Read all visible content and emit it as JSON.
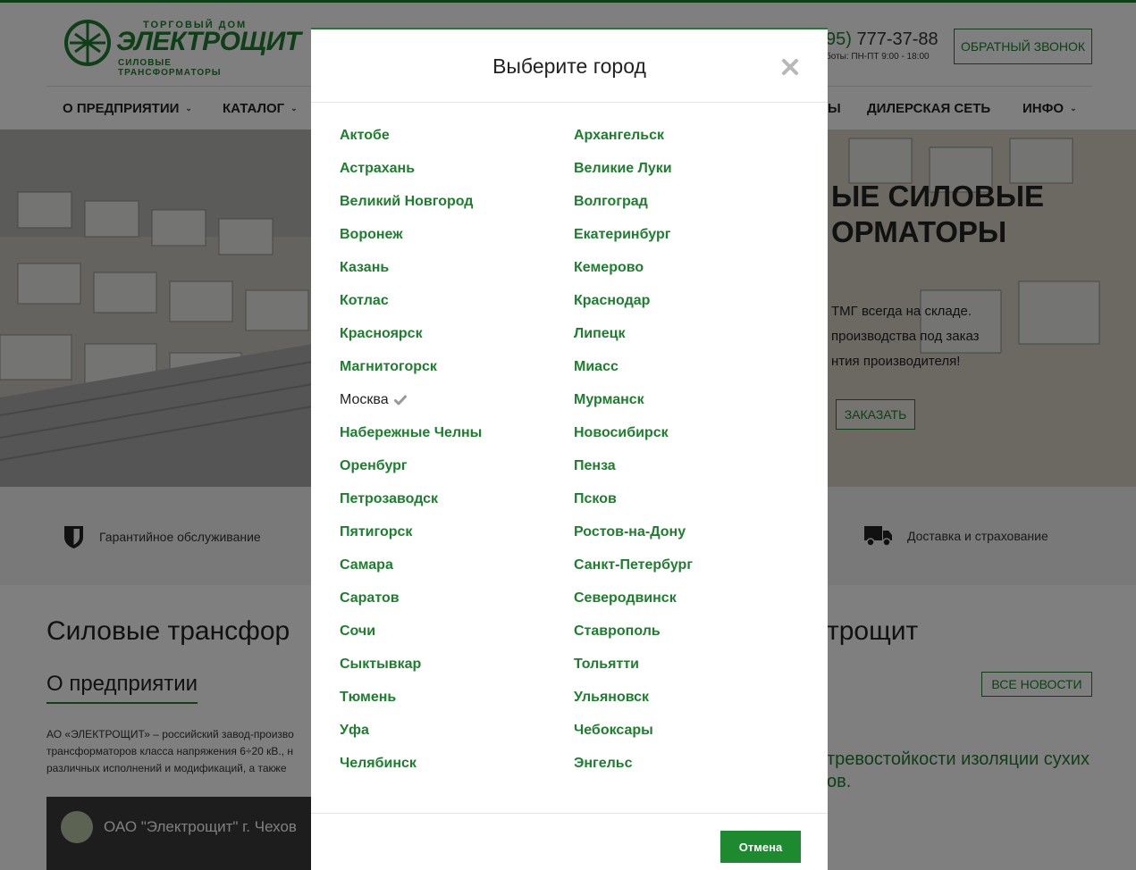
{
  "header": {
    "logo_top": "ТОРГОВЫЙ ДОМ",
    "logo_main": "ЭЛЕКТРОЩИТ",
    "logo_sub": "СИЛОВЫЕ ТРАНСФОРМАТОРЫ",
    "phone_code": "95)",
    "phone_number": " 777-37-88",
    "hours": "боты: ПН-ПТ 9:00 - 18:00",
    "callback_label": "ОБРАТНЫЙ ЗВОНОК"
  },
  "nav": {
    "items": [
      {
        "label": "О ПРЕДПРИЯТИИ",
        "caret": "⌄"
      },
      {
        "label": "КАТАЛОГ",
        "caret": "⌄"
      },
      {
        "label": "Ы",
        "caret": ""
      },
      {
        "label": "ДИЛЕРСКАЯ СЕТЬ",
        "caret": ""
      },
      {
        "label": "ИНФО",
        "caret": "⌄"
      }
    ]
  },
  "hero": {
    "title_line1": "ЫЕ СИЛОВЫЕ",
    "title_line2": "ОРМАТОРЫ",
    "text_line1": "ТМГ всегда на складе.",
    "text_line2": "производства под заказ",
    "text_line3": "нтия производителя!",
    "order_label": "ЗАКАЗАТЬ"
  },
  "features": {
    "warranty": "Гарантийное обслуживание",
    "delivery": "Доставка и страхование"
  },
  "content": {
    "main_heading": "Силовые трансфор",
    "main_heading_right": "трощит",
    "about_heading": "О предприятии",
    "news_button": "ВСЕ НОВОСТИ",
    "about_text": "АО «ЭЛЕКТРОЩИТ» – российский завод-произво трансформаторов класса напряжения 6÷20 кВ., н различных исполнений и модификаций, а также",
    "news_text": "тревостойкости изоляции сухих ов.",
    "video_title": "ОАО \"Электрощит\" г. Чехов"
  },
  "modal": {
    "title": "Выберите город",
    "cancel_label": "Отмена",
    "current_city": "Москва",
    "left_cities": [
      "Актобе",
      "Астрахань",
      "Великий Новгород",
      "Воронеж",
      "Казань",
      "Котлас",
      "Красноярск",
      "Магнитогорск",
      "Москва",
      "Набережные Челны",
      "Оренбург",
      "Петрозаводск",
      "Пятигорск",
      "Самара",
      "Саратов",
      "Сочи",
      "Сыктывкар",
      "Тюмень",
      "Уфа",
      "Челябинск"
    ],
    "right_cities": [
      "Архангельск",
      "Великие Луки",
      "Волгоград",
      "Екатеринбург",
      "Кемерово",
      "Краснодар",
      "Липецк",
      "Миасс",
      "Мурманск",
      "Новосибирск",
      "Пенза",
      "Псков",
      "Ростов-на-Дону",
      "Санкт-Петербург",
      "Северодвинск",
      "Ставрополь",
      "Тольятти",
      "Ульяновск",
      "Чебоксары",
      "Энгельс"
    ]
  },
  "colors": {
    "brand_green": "#1d7f2e",
    "button_green": "#1d8a2f",
    "overlay": "rgba(0,0,0,0.5)"
  },
  "icons": {
    "close": "close-icon",
    "current_city_check": "checkmark-icon",
    "warranty": "shield-icon",
    "delivery": "truck-icon"
  }
}
